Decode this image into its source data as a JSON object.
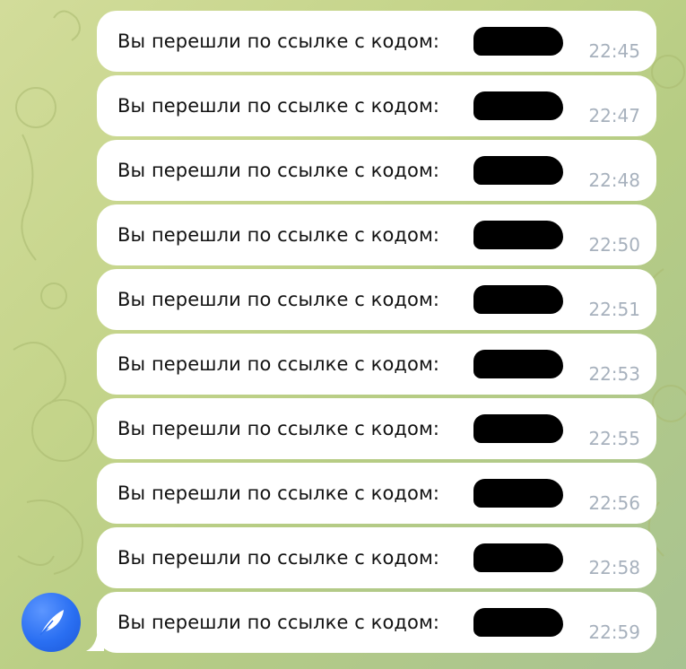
{
  "chat": {
    "messages": [
      {
        "text": "Вы перешли по ссылке с кодом:",
        "time": "22:45"
      },
      {
        "text": "Вы перешли по ссылке с кодом:",
        "time": "22:47"
      },
      {
        "text": "Вы перешли по ссылке с кодом:",
        "time": "22:48"
      },
      {
        "text": "Вы перешли по ссылке с кодом:",
        "time": "22:50"
      },
      {
        "text": "Вы перешли по ссылке с кодом:",
        "time": "22:51"
      },
      {
        "text": "Вы перешли по ссылке с кодом:",
        "time": "22:53"
      },
      {
        "text": "Вы перешли по ссылке с кодом:",
        "time": "22:55"
      },
      {
        "text": "Вы перешли по ссылке с кодом:",
        "time": "22:56"
      },
      {
        "text": "Вы перешли по ссылке с кодом:",
        "time": "22:58"
      },
      {
        "text": "Вы перешли по ссылке с кодом:",
        "time": "22:59"
      }
    ],
    "sender_avatar_icon": "quill-feather-icon"
  },
  "colors": {
    "bubble": "#ffffff",
    "time_text": "#a7b1bd",
    "avatar_blue": "#2a6ff2",
    "wallpaper": "#c4d48a"
  }
}
